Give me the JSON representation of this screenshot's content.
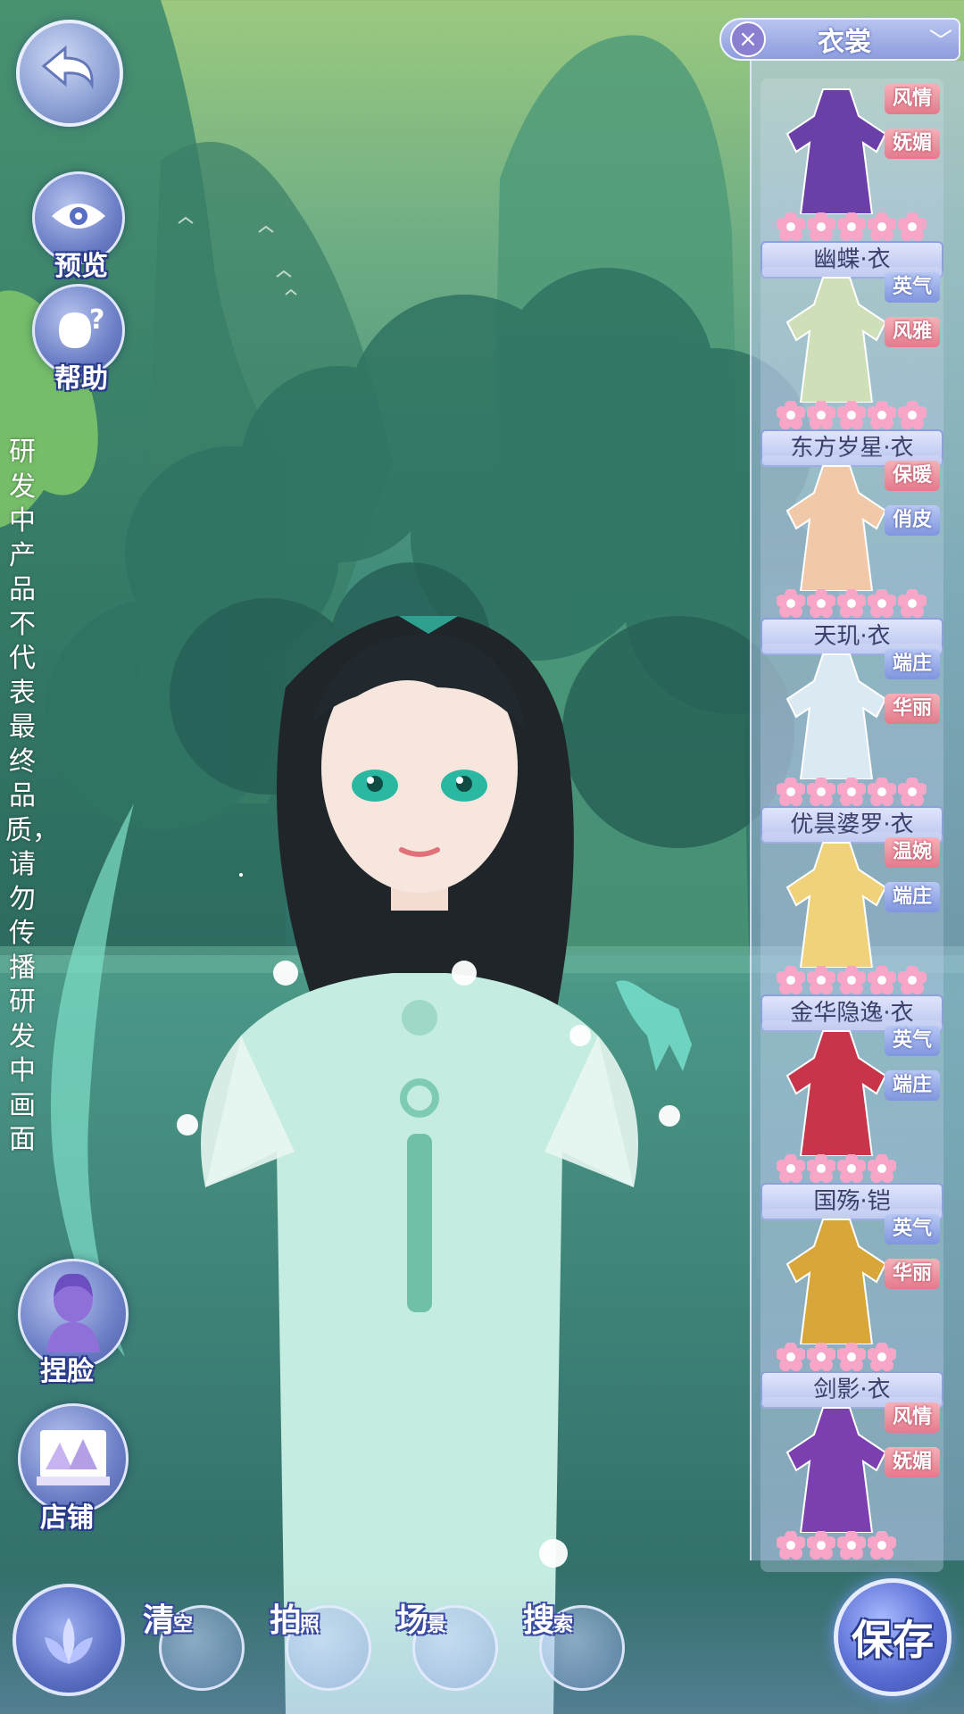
{
  "left_menu": {
    "preview_label": "预览",
    "help_label": "帮助",
    "face_label": "捏脸",
    "shop_label": "店铺"
  },
  "notice": "研发中产品不代表最终品质，请勿传播研发中画面",
  "wardrobe": {
    "title": "衣裳",
    "items": [
      {
        "name": "幽蝶·衣",
        "tags": [
          {
            "text": "风情",
            "color": "pink"
          },
          {
            "text": "妩媚",
            "color": "pink"
          }
        ],
        "outfit_color": "#6a3fa8",
        "flowers": 5
      },
      {
        "name": "东方岁星·衣",
        "tags": [
          {
            "text": "英气",
            "color": "blue"
          },
          {
            "text": "风雅",
            "color": "pink"
          }
        ],
        "outfit_color": "#cfe0b8",
        "flowers": 5
      },
      {
        "name": "天玑·衣",
        "tags": [
          {
            "text": "保暖",
            "color": "pink"
          },
          {
            "text": "俏皮",
            "color": "blue"
          }
        ],
        "outfit_color": "#f1c9a8",
        "flowers": 5
      },
      {
        "name": "优昙婆罗·衣",
        "tags": [
          {
            "text": "端庄",
            "color": "blue"
          },
          {
            "text": "华丽",
            "color": "pink"
          }
        ],
        "outfit_color": "#dbe9f2",
        "flowers": 5
      },
      {
        "name": "金华隐逸·衣",
        "tags": [
          {
            "text": "温婉",
            "color": "pink"
          },
          {
            "text": "端庄",
            "color": "blue"
          }
        ],
        "outfit_color": "#f0d27a",
        "flowers": 5
      },
      {
        "name": "国殇·铠",
        "tags": [
          {
            "text": "英气",
            "color": "blue"
          },
          {
            "text": "端庄",
            "color": "blue"
          }
        ],
        "outfit_color": "#c8344a",
        "flowers": 4
      },
      {
        "name": "剑影·衣",
        "tags": [
          {
            "text": "英气",
            "color": "blue"
          },
          {
            "text": "华丽",
            "color": "pink"
          }
        ],
        "outfit_color": "#d9a63a",
        "flowers": 4
      },
      {
        "name": "",
        "tags": [
          {
            "text": "风情",
            "color": "pink"
          },
          {
            "text": "妩媚",
            "color": "pink"
          }
        ],
        "outfit_color": "#7b3fb0",
        "flowers": 4
      }
    ]
  },
  "toolbar": {
    "clear_label": "清",
    "clear_small": "空",
    "photo_label": "拍",
    "photo_small": "照",
    "scene_label": "场",
    "scene_small": "景",
    "search_label": "搜",
    "search_small": "索",
    "save_label": "保存"
  },
  "colors": {
    "accent": "#6c7fc6",
    "tag_pink": "#e47a8c",
    "tag_blue": "#7f95de",
    "flower": "#f7a6c8"
  }
}
